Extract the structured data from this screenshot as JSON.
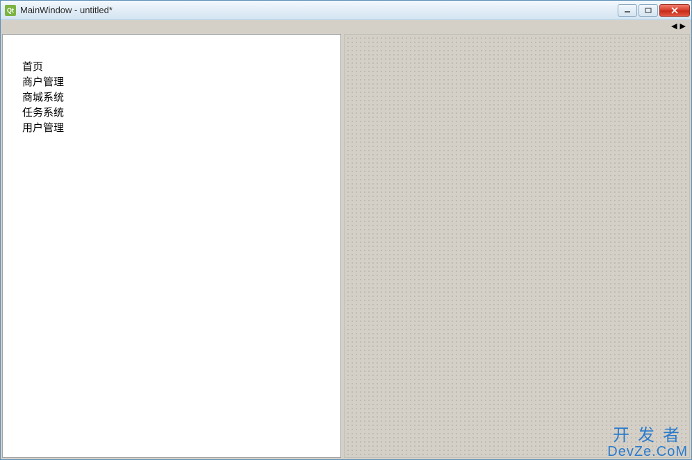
{
  "window": {
    "title": "MainWindow - untitled*",
    "app_icon_text": "Qt"
  },
  "menu": {
    "items": [
      {
        "label": "首页"
      },
      {
        "label": "商户管理"
      },
      {
        "label": "商城系统"
      },
      {
        "label": "任务系统"
      },
      {
        "label": "用户管理"
      }
    ]
  },
  "watermark": {
    "cn": "开发者",
    "en": "DevZe.CoM"
  },
  "colors": {
    "accent": "#2b7bcc",
    "close_btn": "#d9422f"
  }
}
